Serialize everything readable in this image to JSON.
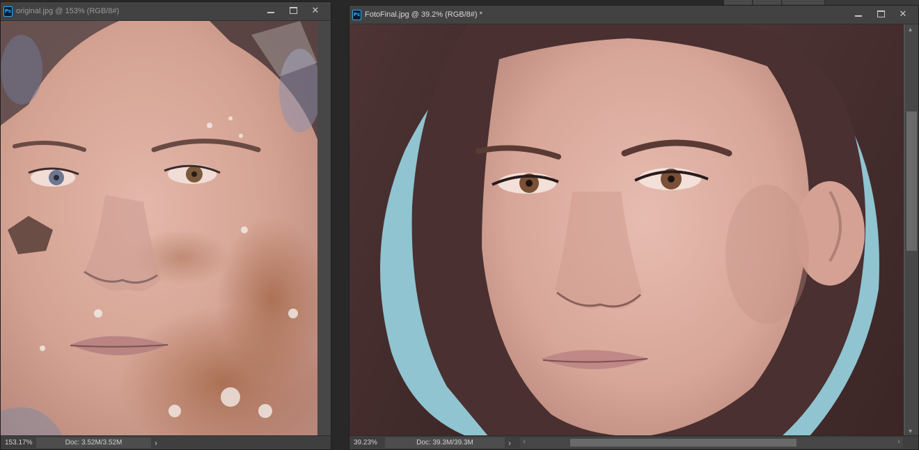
{
  "window1": {
    "title": "original.jpg @ 153% (RGB/8#)",
    "zoom": "153.17%",
    "doc_info": "Doc: 3.52M/3.52M"
  },
  "window2": {
    "title": "FotoFinal.jpg @ 39.2% (RGB/8#) *",
    "zoom": "39.23%",
    "doc_info": "Doc: 39.3M/39.3M"
  },
  "icons": {
    "app": "Ps",
    "minimize": "minimize-icon",
    "maximize": "maximize-icon",
    "close": "close-icon"
  },
  "colors": {
    "app_bg": "#282828",
    "canvas_bg": "#535353",
    "photoshop_blue": "#31a8ff"
  }
}
